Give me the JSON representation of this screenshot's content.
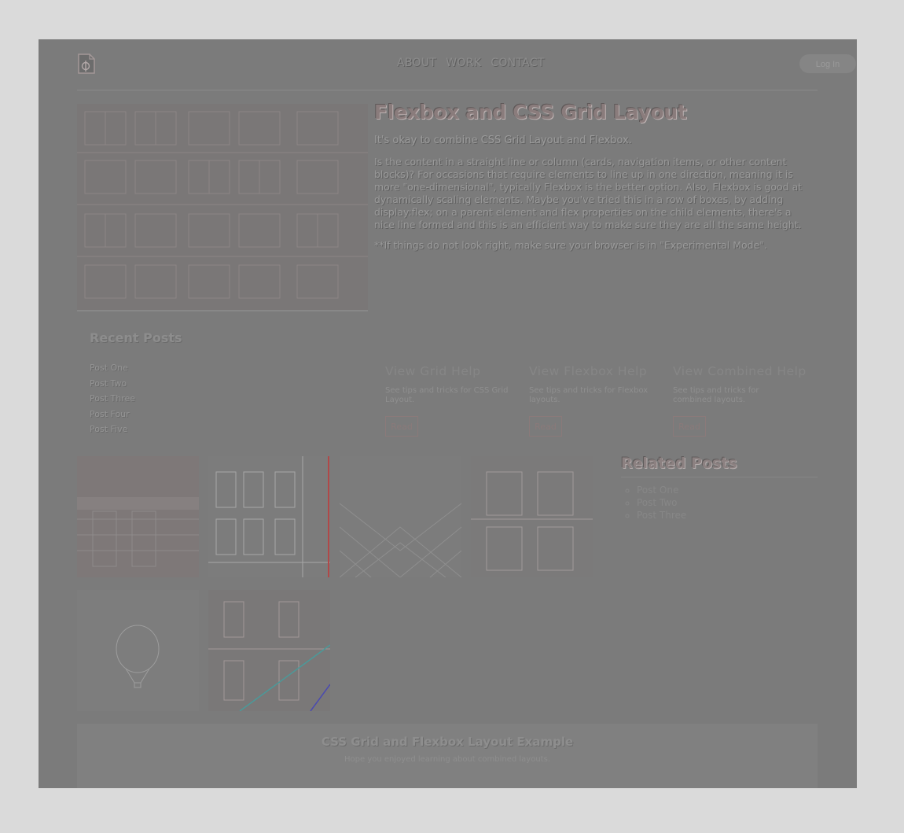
{
  "header": {
    "nav": [
      "ABOUT",
      "WORK",
      "CONTACT"
    ],
    "login_label": "Log In"
  },
  "hero": {
    "title": "Flexbox and CSS Grid Layout",
    "subtitle": "It's okay to combine CSS Grid Layout and Flexbox.",
    "body": "Is the content in a straight line or column (cards, navigation items, or other content blocks)? For occasions that require elements to line up in one direction, meaning it is more \"one-dimensional\", typically Flexbox is the better option. Also, Flexbox is good at dynamically scaling elements. Maybe you've tried this in a row of boxes, by adding display:flex; on a parent element and flex properties on the child elements, there's a nice line formed and this is an efficient way to make sure they are all the same height.",
    "note": "**If things do not look right, make sure your browser is in \"Experimental Mode\"."
  },
  "recent_posts": {
    "title": "Recent Posts",
    "items": [
      "Post One",
      "Post Two",
      "Post Three",
      "Post Four",
      "Post Five"
    ]
  },
  "cards": [
    {
      "title": "View Grid Help",
      "text": "See tips and tricks for CSS Grid Layout.",
      "button": "Read"
    },
    {
      "title": "View Flexbox Help",
      "text": "See tips and tricks for Flexbox layouts.",
      "button": "Read"
    },
    {
      "title": "View Combined Help",
      "text": "See tips and tricks for combined layouts.",
      "button": "Read"
    }
  ],
  "related_posts": {
    "title": "Related Posts",
    "items": [
      "Post One",
      "Post Two",
      "Post Three"
    ]
  },
  "footer": {
    "title": "CSS Grid and Flexbox Layout Example",
    "text": "Hope you enjoyed learning about combined layouts."
  }
}
